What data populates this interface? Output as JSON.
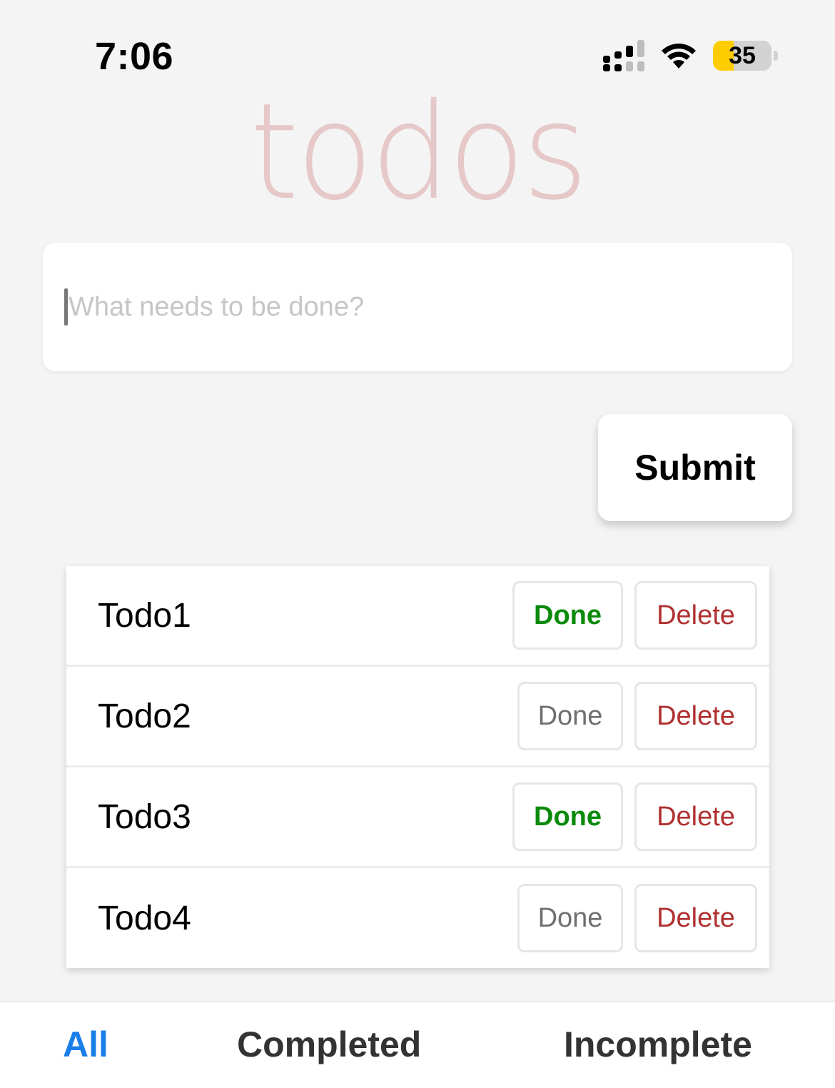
{
  "status_bar": {
    "time": "7:06",
    "battery_level": "35",
    "icons": [
      "signal-icon",
      "wifi-icon",
      "battery-icon"
    ]
  },
  "app": {
    "title": "todos"
  },
  "input": {
    "placeholder": "What needs to be done?",
    "value": ""
  },
  "submit_label": "Submit",
  "todos": [
    {
      "label": "Todo1",
      "done_label": "Done",
      "done_active": true,
      "delete_label": "Delete"
    },
    {
      "label": "Todo2",
      "done_label": "Done",
      "done_active": false,
      "delete_label": "Delete"
    },
    {
      "label": "Todo3",
      "done_label": "Done",
      "done_active": true,
      "delete_label": "Delete"
    },
    {
      "label": "Todo4",
      "done_label": "Done",
      "done_active": false,
      "delete_label": "Delete"
    }
  ],
  "tabs": [
    {
      "label": "All",
      "active": true
    },
    {
      "label": "Completed",
      "active": false
    },
    {
      "label": "Incomplete",
      "active": false
    }
  ],
  "colors": {
    "accent": "#1a7ee8",
    "done_active": "#0a8a0a",
    "delete": "#b03030",
    "title": "#e6c8c8",
    "battery": "#ffcc00"
  }
}
